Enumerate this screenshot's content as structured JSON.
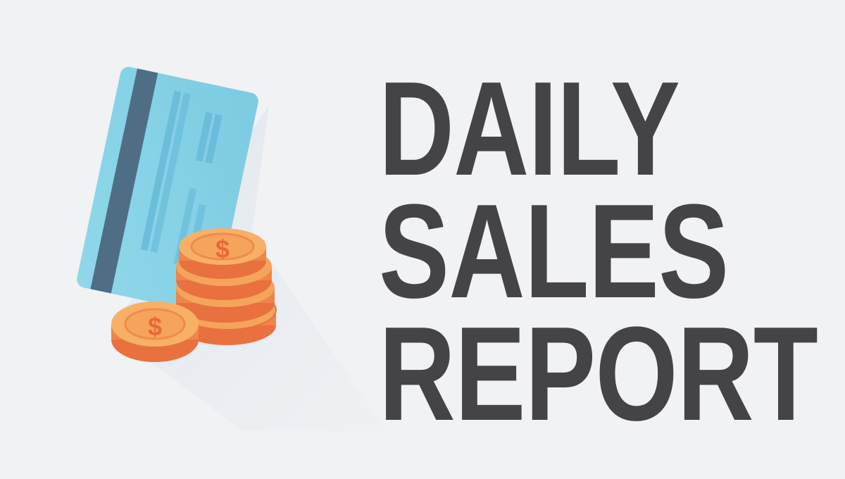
{
  "title": {
    "line1": "DAILY",
    "line2": "SALES",
    "line3": "REPORT"
  },
  "illustration": {
    "card_icon": "credit-card-icon",
    "coin_icon": "dollar-coin-icon",
    "coin_symbol": "$"
  },
  "colors": {
    "background": "#f1f2f4",
    "title_text": "#444446",
    "card_face": "#86d2e6",
    "card_stripe": "#4f6e85",
    "coin_face": "#f5a45b",
    "coin_edge": "#f0854a",
    "coin_symbol": "#e8683a"
  }
}
